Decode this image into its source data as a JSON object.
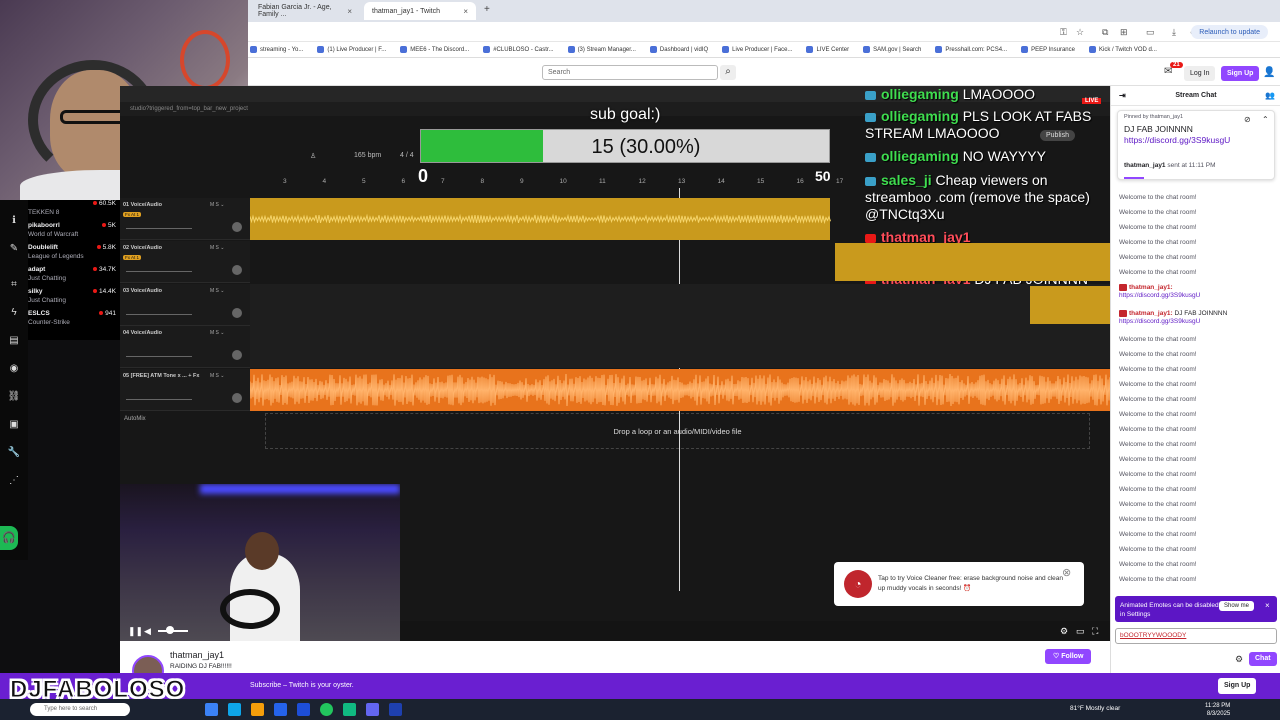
{
  "browser": {
    "tabs": [
      {
        "label": "Fabian Garcia Jr. - Age, Family ...",
        "close": "×"
      },
      {
        "label": "thatman_jay1 - Twitch",
        "close": "×"
      }
    ],
    "new_tab": "+",
    "relaunch_label": "Relaunch to update",
    "bookmarks": [
      "streaming - Yo...",
      "(1) Live Producer | F...",
      "MEE6 - The Discord...",
      "#CLUBLOSO - Castr...",
      "(3) Stream Manager...",
      "Dashboard | vidIQ",
      "Live Producer | Face...",
      "LIVE Center",
      "SAM.gov | Search",
      "Presshall.com: PCS4...",
      "PEEP Insurance",
      "Kick / Twitch VOD d..."
    ]
  },
  "twitch": {
    "search_placeholder": "Search",
    "notif_count": "21",
    "login_label": "Log In",
    "signup_label": "Sign Up",
    "icons": {
      "search": "search-icon",
      "notif": "inbox-icon",
      "user": "user-icon"
    }
  },
  "sidebar": {
    "channels": [
      {
        "name": "",
        "game": "TEKKEN 8",
        "viewers": "60.5K"
      },
      {
        "name": "pikaboorrl",
        "game": "World of Warcraft",
        "viewers": "5K"
      },
      {
        "name": "Doublelift",
        "game": "League of Legends",
        "viewers": "5.8K"
      },
      {
        "name": "adapt",
        "game": "Just Chatting",
        "viewers": "34.7K"
      },
      {
        "name": "silky",
        "game": "Just Chatting",
        "viewers": "14.4K"
      },
      {
        "name": "ESLCS",
        "game": "Counter-Strike",
        "viewers": "941"
      }
    ]
  },
  "stream": {
    "sub_goal_title": "sub goal:)",
    "sub_goal_text": "15 (30.00%)",
    "sub_goal_current": 15,
    "sub_goal_fraction": 0.3,
    "goal_min": "0",
    "goal_max": "50",
    "live_badge": "LIVE",
    "publish_label": "Publish",
    "daw_url": "studio?triggered_from=top_bar_new_project",
    "bpm": "165 bpm",
    "time_sig": "4 / 4",
    "ruler": [
      "3",
      "4",
      "5",
      "6",
      "7",
      "8",
      "9",
      "10",
      "11",
      "12",
      "13",
      "14",
      "15",
      "16",
      "17"
    ],
    "tracks": [
      {
        "name": "01 Voice/Audio",
        "fx": "Fx At 1"
      },
      {
        "name": "02 Voice/Audio",
        "fx": "Fx At 1"
      },
      {
        "name": "03 Voice/Audio",
        "fx": ""
      },
      {
        "name": "04 Voice/Audio",
        "fx": ""
      },
      {
        "name": "05 [FREE] ATM Tone x ... + Fx",
        "fx": ""
      }
    ],
    "automix": "AutoMix",
    "drop_text": "Drop a loop or an audio/MIDI/video file",
    "overlay_chat": [
      {
        "user": "olliegaming",
        "text": "LMAOOOO",
        "color": "green"
      },
      {
        "user": "olliegaming",
        "text": "PLS LOOK AT FABS STREAM LMAOOOO",
        "color": "green"
      },
      {
        "user": "olliegaming",
        "text": "NO WAYYYY",
        "color": "green"
      },
      {
        "user": "sales_ji",
        "text": "Cheap viewers on streamboo .com (remove the space) @TNCtq3Xu",
        "color": "green"
      },
      {
        "user": "thatman_jay1",
        "text": "https://discord.gg/3S9kusgU",
        "color": "red"
      },
      {
        "user": "thatman_jay1",
        "text": "DJ FAB JOINNNN https://discord.gg/3S9kusgU",
        "color": "red"
      }
    ],
    "voice_cleaner": "Tap to try Voice Cleaner free: erase background noise and clean up muddy vocals in seconds! ⏰",
    "volume_level": 0.4
  },
  "channel_info": {
    "name": "thatman_jay1",
    "title": "RAIDING DJ FAB!!!!!!",
    "follow_label": "Follow"
  },
  "promo": {
    "text": "Subscribe – Twitch is your oyster.",
    "signup_label": "Sign Up",
    "logo": "DJFABOLOSO"
  },
  "taskbar": {
    "search_placeholder": "Type here to search",
    "weather": "81°F  Mostly clear",
    "time": "11:28 PM",
    "date": "8/3/2025"
  },
  "chat": {
    "header": "Stream Chat",
    "pinned_by": "Pinned by thatman_jay1",
    "pinned_text": "DJ FAB JOINNNN",
    "pinned_link": "https://discord.gg/3S9kusgU",
    "pinned_sender": "thatman_jay1",
    "pinned_time": "sent at 11:11 PM",
    "welcome": "Welcome to the chat room!",
    "msg1_user": "thatman_jay1:",
    "msg1_link": "https://discord.gg/3S9kusgU",
    "msg2_user": "thatman_jay1:",
    "msg2_text": "DJ FAB JOINNNN",
    "msg2_link": "https://discord.gg/3S9kusgU",
    "emote_promo": "Animated Emotes can be disabled in Settings",
    "show_me": "Show me",
    "input_value": "bOOOTRYYWOOODY",
    "chat_button": "Chat"
  },
  "colors": {
    "twitch_purple": "#9147ff",
    "goal_green": "#2ebd3c",
    "overlay_green": "#3fdd4f",
    "overlay_red": "#ff4d5a",
    "wave_yellow": "#c99a1d",
    "wave_orange": "#e8731c"
  }
}
